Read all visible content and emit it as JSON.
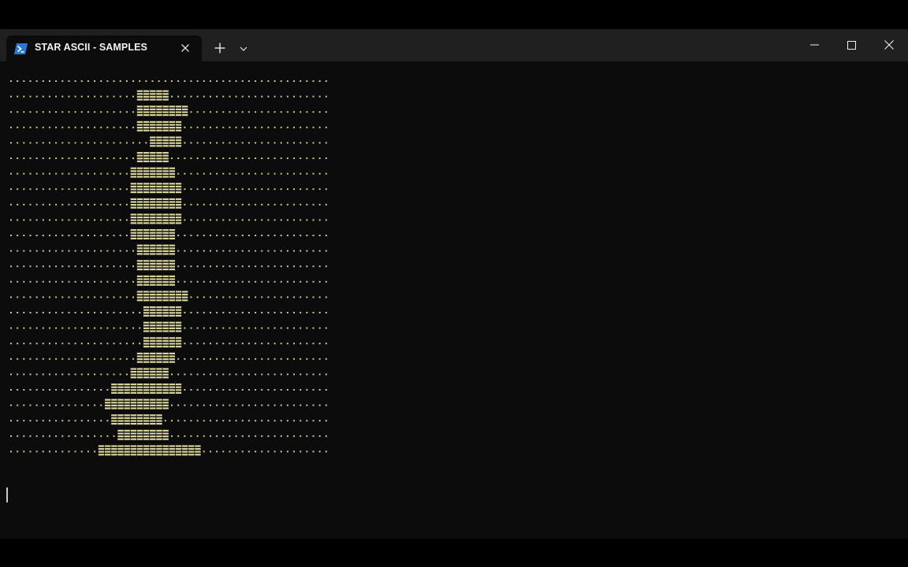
{
  "window": {
    "tab_title": "STAR ASCII - SAMPLES",
    "tab_icon": "powershell-icon",
    "controls": [
      "new-tab-icon",
      "chevron-down-icon",
      "minimize-icon",
      "maximize-icon",
      "close-icon"
    ]
  },
  "terminal": {
    "background": "#0c0c0c",
    "dot_color": "#c9c78c",
    "figure_color": "#d6d49a",
    "dot_char": ".",
    "figure_char": "▒",
    "ascii_art": [
      "..................................................",
      "....................XXXXX.........................",
      "....................XXXXXXXX......................",
      "....................XXXXXXX.......................",
      "......................XXXXX.......................",
      "....................XXXXX.........................",
      "...................XXXXXXX........................",
      "...................XXXXXXXX.......................",
      "...................XXXXXXXX.......................",
      "...................XXXXXXXX.......................",
      "...................XXXXXXX........................",
      "....................XXXXXX........................",
      "....................XXXXXX........................",
      "....................XXXXXX........................",
      "....................XXXXXXXX......................",
      ".....................XXXXXX.......................",
      ".....................XXXXXX.......................",
      ".....................XXXXXX.......................",
      "....................XXXXXX........................",
      "...................XXXXXX.........................",
      "................XXXXXXXXXXX.......................",
      "...............XXXXXXXXXX.........................",
      "................XXXXXXXX..........................",
      ".................XXXXXXXX.........................",
      "..............XXXXXXXXXXXXXXXX...................."
    ]
  }
}
